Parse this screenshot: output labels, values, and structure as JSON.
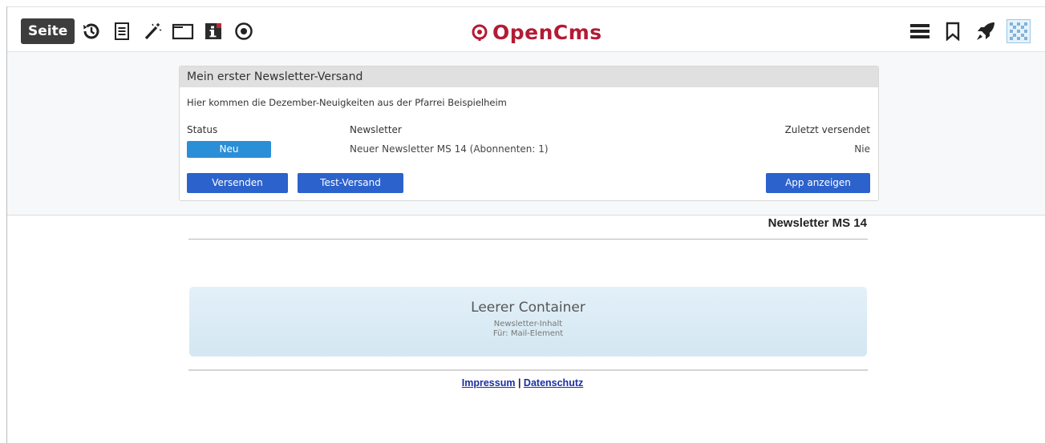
{
  "toolbar": {
    "page_button_label": "Seite",
    "logo_text": "OpenCms",
    "brand_color": "#b31b34",
    "left_icons": [
      "history-icon",
      "notes-icon",
      "wand-icon",
      "folder-icon",
      "info-icon",
      "target-icon"
    ],
    "right_icons": [
      "menu-icon",
      "bookmark-icon",
      "rocket-icon",
      "user-avatar"
    ]
  },
  "dialog": {
    "title": "Mein erster Newsletter-Versand",
    "description": "Hier kommen die Dezember-Neuigkeiten aus der Pfarrei Beispielheim",
    "status_label": "Status",
    "newsletter_label": "Newsletter",
    "last_sent_label": "Zuletzt versendet",
    "status_value": "Neu",
    "newsletter_value": "Neuer Newsletter MS 14 (Abonnenten: 1)",
    "last_sent_value": "Nie",
    "send_button": "Versenden",
    "test_button": "Test-Versand",
    "app_button": "App anzeigen",
    "status_color": "#2a8fd6",
    "button_color": "#2c62cc"
  },
  "page": {
    "title": "Newsletter MS 14",
    "empty_container_title": "Leerer Container",
    "empty_container_sub1": "Newsletter-Inhalt",
    "empty_container_sub2": "Für: Mail-Element"
  },
  "footer": {
    "imprint_link": "Impressum",
    "separator": "|",
    "privacy_link": "Datenschutz"
  }
}
